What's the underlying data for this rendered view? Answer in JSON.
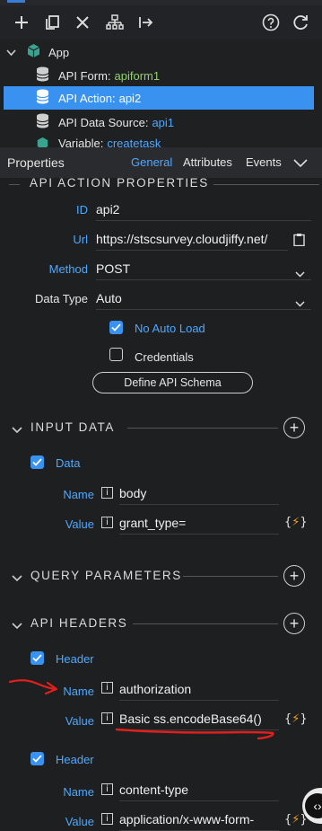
{
  "tree": {
    "root": "App",
    "items": [
      {
        "label": "API Form:",
        "value": "apiform1"
      },
      {
        "label": "API Action:",
        "value": "api2"
      },
      {
        "label": "API Data Source:",
        "value": "api1"
      },
      {
        "label": "Variable:",
        "value": "createtask"
      }
    ]
  },
  "properties": {
    "title": "Properties",
    "tabs": [
      "General",
      "Attributes",
      "Events"
    ]
  },
  "api_action": {
    "section": "API ACTION PROPERTIES",
    "id_label": "ID",
    "id_value": "api2",
    "url_label": "Url",
    "url_value": "https://stscsurvey.cloudjiffy.net/",
    "method_label": "Method",
    "method_value": "POST",
    "datatype_label": "Data Type",
    "datatype_value": "Auto",
    "no_auto_load": "No Auto Load",
    "credentials": "Credentials",
    "define_schema": "Define API Schema"
  },
  "input_data": {
    "section": "INPUT DATA",
    "group": "Data",
    "name_label": "Name",
    "name_value": "body",
    "value_label": "Value",
    "value_value": "grant_type="
  },
  "query": {
    "section": "QUERY PARAMETERS"
  },
  "headers": {
    "section": "API HEADERS",
    "items": [
      {
        "group": "Header",
        "name_label": "Name",
        "name_value": "authorization",
        "value_label": "Value",
        "value_value": "Basic ss.encodeBase64()"
      },
      {
        "group": "Header",
        "name_label": "Name",
        "name_value": "content-type",
        "value_label": "Value",
        "value_value": "application/x-www-form-"
      }
    ]
  },
  "icons": {
    "toolbar": [
      "plus-icon",
      "copy-icon",
      "close-icon",
      "sitemap-icon",
      "arrow-right-bar-icon",
      "help-icon",
      "refresh-icon"
    ],
    "data_binding": "bolt-icon"
  },
  "colors": {
    "accent": "#3a92f0",
    "link": "#4fa8ff",
    "green": "#8fd16b",
    "annotation": "#e0201c"
  }
}
